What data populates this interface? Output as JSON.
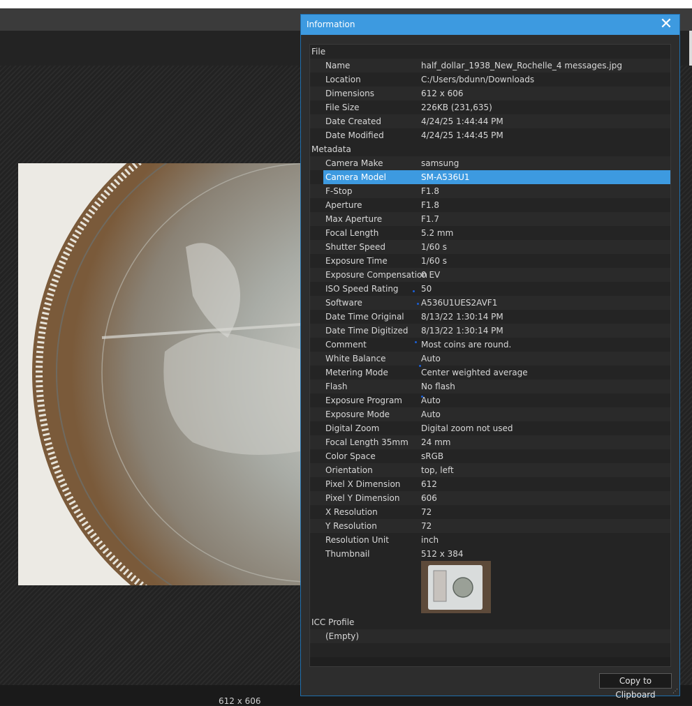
{
  "status": {
    "dimensions": "612 x 606"
  },
  "dialog": {
    "title": "Information",
    "close_glyph": "✕",
    "copy_label": "Copy to Clipboard",
    "sections": {
      "file": "File",
      "metadata": "Metadata",
      "icc": "ICC Profile"
    },
    "file_rows": [
      {
        "label": "Name",
        "value": "half_dollar_1938_New_Rochelle_4 messages.jpg"
      },
      {
        "label": "Location",
        "value": "C:/Users/bdunn/Downloads"
      },
      {
        "label": "Dimensions",
        "value": "612 x 606"
      },
      {
        "label": "File Size",
        "value": "226KB (231,635)"
      },
      {
        "label": "Date Created",
        "value": "4/24/25 1:44:44 PM"
      },
      {
        "label": "Date Modified",
        "value": "4/24/25 1:44:45 PM"
      }
    ],
    "metadata_rows": [
      {
        "label": "Camera Make",
        "value": "samsung"
      },
      {
        "label": "Camera Model",
        "value": "SM-A536U1"
      },
      {
        "label": "F-Stop",
        "value": "F1.8"
      },
      {
        "label": "Aperture",
        "value": "F1.8"
      },
      {
        "label": "Max Aperture",
        "value": "F1.7"
      },
      {
        "label": "Focal Length",
        "value": "5.2 mm"
      },
      {
        "label": "Shutter Speed",
        "value": "1/60 s"
      },
      {
        "label": "Exposure Time",
        "value": "1/60 s"
      },
      {
        "label": "Exposure Compensation",
        "value": "0 EV"
      },
      {
        "label": "ISO Speed Rating",
        "value": "50"
      },
      {
        "label": "Software",
        "value": "A536U1UES2AVF1"
      },
      {
        "label": "Date Time Original",
        "value": "8/13/22 1:30:14 PM"
      },
      {
        "label": "Date Time Digitized",
        "value": "8/13/22 1:30:14 PM"
      },
      {
        "label": "Comment",
        "value": "Most coins are round."
      },
      {
        "label": "White Balance",
        "value": "Auto"
      },
      {
        "label": "Metering Mode",
        "value": "Center weighted average"
      },
      {
        "label": "Flash",
        "value": "No flash"
      },
      {
        "label": "Exposure Program",
        "value": "Auto"
      },
      {
        "label": "Exposure Mode",
        "value": "Auto"
      },
      {
        "label": "Digital Zoom",
        "value": "Digital zoom not used"
      },
      {
        "label": "Focal Length 35mm",
        "value": "24 mm"
      },
      {
        "label": "Color Space",
        "value": "sRGB"
      },
      {
        "label": "Orientation",
        "value": "top, left"
      },
      {
        "label": "Pixel X Dimension",
        "value": "612"
      },
      {
        "label": "Pixel Y Dimension",
        "value": "606"
      },
      {
        "label": "X Resolution",
        "value": "72"
      },
      {
        "label": "Y Resolution",
        "value": "72"
      },
      {
        "label": "Resolution Unit",
        "value": "inch"
      }
    ],
    "thumbnail": {
      "label": "Thumbnail",
      "value": "512 x 384"
    },
    "icc_rows": [
      {
        "label": "(Empty)",
        "value": ""
      }
    ],
    "selected_label": "Camera Model",
    "accent_color": "#3d9ae0"
  }
}
